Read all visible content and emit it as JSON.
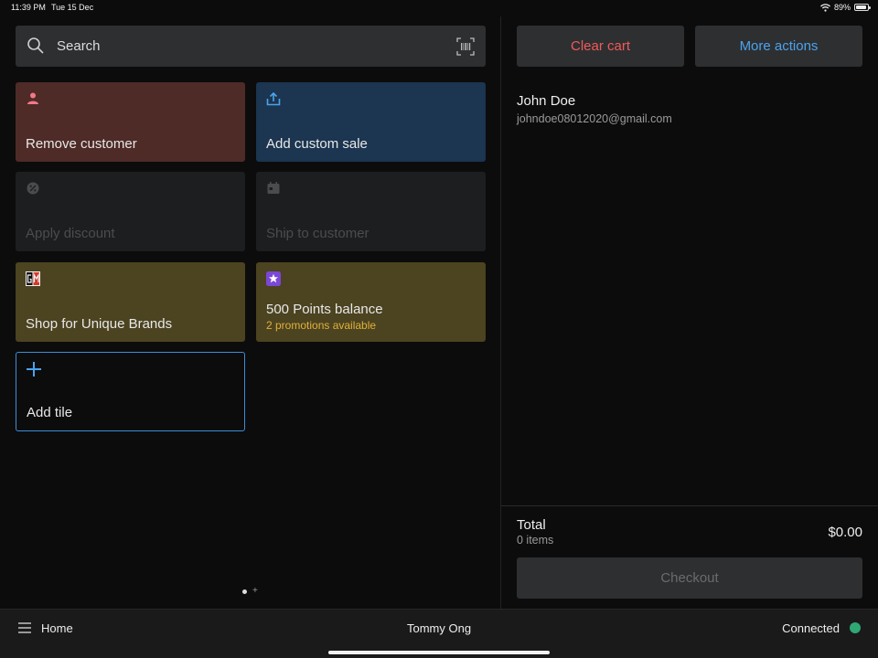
{
  "status_bar": {
    "time": "11:39 PM",
    "date": "Tue 15 Dec",
    "battery": "89%"
  },
  "search": {
    "placeholder": "Search"
  },
  "tiles": [
    {
      "label": "Remove customer",
      "icon": "person-icon"
    },
    {
      "label": "Add custom sale",
      "icon": "tray-upload-icon"
    },
    {
      "label": "Apply discount",
      "icon": "discount-badge-icon"
    },
    {
      "label": "Ship to customer",
      "icon": "calendar-icon"
    },
    {
      "label": "Shop for Unique Brands",
      "icon": "gm-logo-icon"
    },
    {
      "label": "500 Points balance",
      "sub": "2 promotions available",
      "icon": "star-badge-icon"
    },
    {
      "label": "Add tile",
      "icon": "plus-icon"
    }
  ],
  "cart": {
    "clear_label": "Clear cart",
    "more_label": "More actions",
    "customer_name": "John Doe",
    "customer_email": "johndoe08012020@gmail.com",
    "total_label": "Total",
    "items_label": "0 items",
    "total_value": "$0.00",
    "checkout_label": "Checkout"
  },
  "bottom_bar": {
    "home_label": "Home",
    "user": "Tommy Ong",
    "connection": "Connected"
  },
  "colors": {
    "remove_tile": "#4e2b27",
    "custom_sale_tile": "#1c3550",
    "disabled_tile": "#1d1e20",
    "brand_tile": "#4c4320",
    "accent_blue": "#4aa3ee",
    "danger_red": "#f05a5a",
    "promo_yellow": "#e0b13a",
    "connected_green": "#2fa874"
  }
}
